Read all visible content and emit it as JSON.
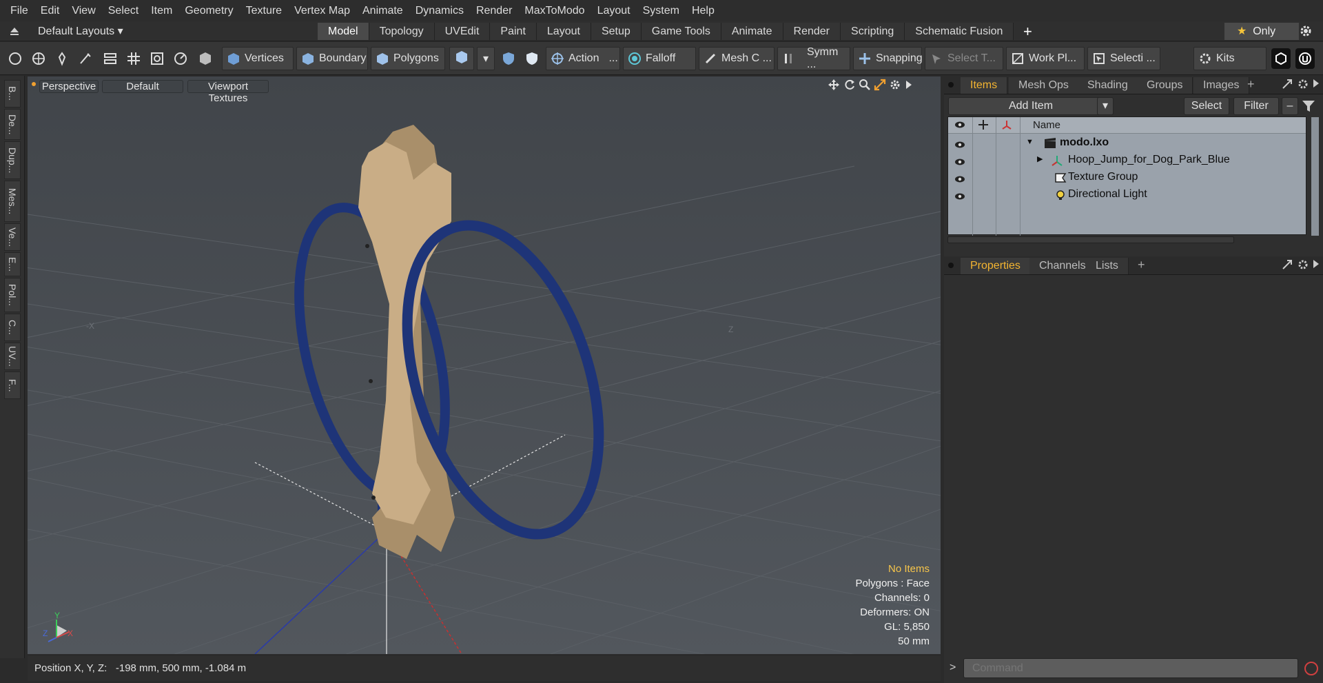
{
  "menu": [
    "File",
    "Edit",
    "View",
    "Select",
    "Item",
    "Geometry",
    "Texture",
    "Vertex Map",
    "Animate",
    "Dynamics",
    "Render",
    "MaxToModo",
    "Layout",
    "System",
    "Help"
  ],
  "layout_bar": {
    "layouts_label": "Default Layouts",
    "tabs": [
      {
        "label": "Model",
        "active": true
      },
      {
        "label": "Topology"
      },
      {
        "label": "UVEdit"
      },
      {
        "label": "Paint"
      },
      {
        "label": "Layout"
      },
      {
        "label": "Setup"
      },
      {
        "label": "Game Tools"
      },
      {
        "label": "Animate"
      },
      {
        "label": "Render"
      },
      {
        "label": "Scripting"
      },
      {
        "label": "Schematic Fusion"
      }
    ],
    "add_tab": "+",
    "only_label": "Only"
  },
  "toolbar": {
    "vertices": "Vertices",
    "boundary": "Boundary",
    "polygons": "Polygons",
    "action": "Action",
    "action_more": "...",
    "falloff": "Falloff",
    "mesh_c": "Mesh C ...",
    "symm": "Symm ...",
    "snapping": "Snapping",
    "select_t": "Select T...",
    "work_pl": "Work Pl...",
    "selecti": "Selecti ...",
    "kits": "Kits"
  },
  "left_strip": [
    "B...",
    "De...",
    "Dup...",
    "Mes...",
    "Ve...",
    "E...",
    "Pol...",
    "C...",
    "UV...",
    "F..."
  ],
  "viewport": {
    "perspective": "Perspective",
    "default": "Default",
    "textures": "Viewport Textures",
    "axis_x_neg": "-X",
    "axis_z": "Z",
    "gizmo_y": "Y",
    "gizmo_x": "X",
    "gizmo_z": "Z",
    "colors": {
      "hoop": "#1e3478",
      "bone": "#c9ad86",
      "background": "#4a4f55"
    },
    "info": {
      "no_items": "No Items",
      "polygons": "Polygons : Face",
      "channels": "Channels: 0",
      "deformers": "Deformers: ON",
      "gl": "GL: 5,850",
      "scale": "50 mm"
    }
  },
  "status": {
    "position_label": "Position X, Y, Z:",
    "position_value": "-198 mm, 500 mm, -1.084 m"
  },
  "items_panel": {
    "tabs": [
      {
        "label": "Items",
        "active": true
      },
      {
        "label": "Mesh Ops"
      },
      {
        "label": "Shading"
      },
      {
        "label": "Groups"
      },
      {
        "label": "Images"
      }
    ],
    "add_item": "Add Item",
    "select": "Select",
    "filter": "Filter",
    "name_header": "Name",
    "items": [
      {
        "name": "modo.lxo",
        "bold": true
      },
      {
        "name": "Hoop_Jump_for_Dog_Park_Blue"
      },
      {
        "name": "Texture Group"
      },
      {
        "name": "Directional Light"
      }
    ]
  },
  "properties_panel": {
    "tabs": [
      {
        "label": "Properties",
        "active": true
      },
      {
        "label": "Channels"
      },
      {
        "label": "Lists"
      }
    ]
  },
  "command": {
    "placeholder": "Command",
    "prompt": ">"
  }
}
